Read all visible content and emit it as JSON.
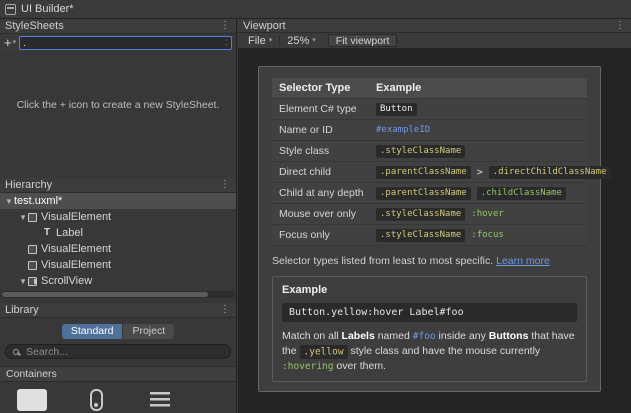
{
  "window": {
    "title": "UI Builder*"
  },
  "icons": {
    "menu": "⋮",
    "caret_down": "▾",
    "foldout_open": "▼",
    "plus": "+"
  },
  "colors": {
    "accent": "#4f83e3",
    "tok-blue": "#6f9ae2",
    "tok-yellow": "#d2c976",
    "tok-green": "#93c763",
    "tab-active": "#4e719c"
  },
  "left": {
    "stylesheets": {
      "title": "StyleSheets",
      "selector_field": {
        "value": ".",
        "suffix": ":"
      },
      "empty_message": "Click the + icon to create a new StyleSheet."
    },
    "hierarchy": {
      "title": "Hierarchy",
      "items": [
        {
          "label": "test.uxml*",
          "depth": 0,
          "arrow": true,
          "icon": "none",
          "selected": true
        },
        {
          "label": "VisualElement",
          "depth": 1,
          "arrow": true,
          "icon": "visual-element",
          "selected": false
        },
        {
          "label": "Label",
          "depth": 2,
          "arrow": false,
          "icon": "label",
          "selected": false
        },
        {
          "label": "VisualElement",
          "depth": 1,
          "arrow": false,
          "icon": "visual-element",
          "selected": false
        },
        {
          "label": "VisualElement",
          "depth": 1,
          "arrow": false,
          "icon": "visual-element",
          "selected": false
        },
        {
          "label": "ScrollView",
          "depth": 1,
          "arrow": true,
          "icon": "scroll-view",
          "selected": false
        }
      ]
    },
    "library": {
      "title": "Library",
      "tabs": [
        {
          "label": "Standard",
          "active": true
        },
        {
          "label": "Project",
          "active": false
        }
      ],
      "search_placeholder": "Search...",
      "section": "Containers",
      "items": [
        {
          "name": "visual-element"
        },
        {
          "name": "scroll-view"
        },
        {
          "name": "list-view"
        }
      ]
    }
  },
  "viewport": {
    "title": "Viewport",
    "toolbar": {
      "file_label": "File",
      "zoom_label": "25%",
      "fit_label": "Fit viewport"
    },
    "cheatsheet": {
      "table": {
        "headers": [
          "Selector Type",
          "Example"
        ],
        "rows": [
          {
            "label": "Element C# type",
            "tokens": [
              {
                "text": "Button",
                "style": "white",
                "chip": true
              }
            ]
          },
          {
            "label": "Name or ID",
            "tokens": [
              {
                "text": "#exampleID",
                "style": "blue",
                "chip": false
              }
            ]
          },
          {
            "label": "Style class",
            "tokens": [
              {
                "text": ".styleClassName",
                "style": "yellow",
                "chip": true
              }
            ]
          },
          {
            "label": "Direct child",
            "tokens": [
              {
                "text": ".parentClassName",
                "style": "yellow",
                "chip": true
              },
              {
                "text": ">",
                "style": "plain",
                "chip": false
              },
              {
                "text": ".directChildClassName",
                "style": "yellow",
                "chip": true
              }
            ]
          },
          {
            "label": "Child at any depth",
            "tokens": [
              {
                "text": ".parentClassName",
                "style": "yellow",
                "chip": true
              },
              {
                "text": ".childClassName",
                "style": "green",
                "chip": true
              }
            ]
          },
          {
            "label": "Mouse over only",
            "tokens": [
              {
                "text": ".styleClassName",
                "style": "yellow",
                "chip": true
              },
              {
                "text": ":hover",
                "style": "green",
                "chip": false
              }
            ]
          },
          {
            "label": "Focus only",
            "tokens": [
              {
                "text": ".styleClassName",
                "style": "yellow",
                "chip": true
              },
              {
                "text": ":focus",
                "style": "green",
                "chip": false
              }
            ]
          }
        ]
      },
      "note_text": "Selector types listed from least to most specific.",
      "note_link": "Learn more",
      "example": {
        "title": "Example",
        "code": "Button.yellow:hover Label#foo",
        "description": [
          {
            "text": "Match on all ",
            "style": "plain"
          },
          {
            "text": "Labels",
            "style": "bold"
          },
          {
            "text": " named ",
            "style": "plain"
          },
          {
            "text": "#foo",
            "style": "blue"
          },
          {
            "text": " inside any ",
            "style": "plain"
          },
          {
            "text": "Buttons",
            "style": "bold"
          },
          {
            "text": " that have the ",
            "style": "plain"
          },
          {
            "text": ".yellow",
            "style": "yellow-chip"
          },
          {
            "text": " style class and have the mouse currently ",
            "style": "plain"
          },
          {
            "text": ":hovering",
            "style": "green"
          },
          {
            "text": " over them.",
            "style": "plain"
          }
        ]
      }
    }
  }
}
